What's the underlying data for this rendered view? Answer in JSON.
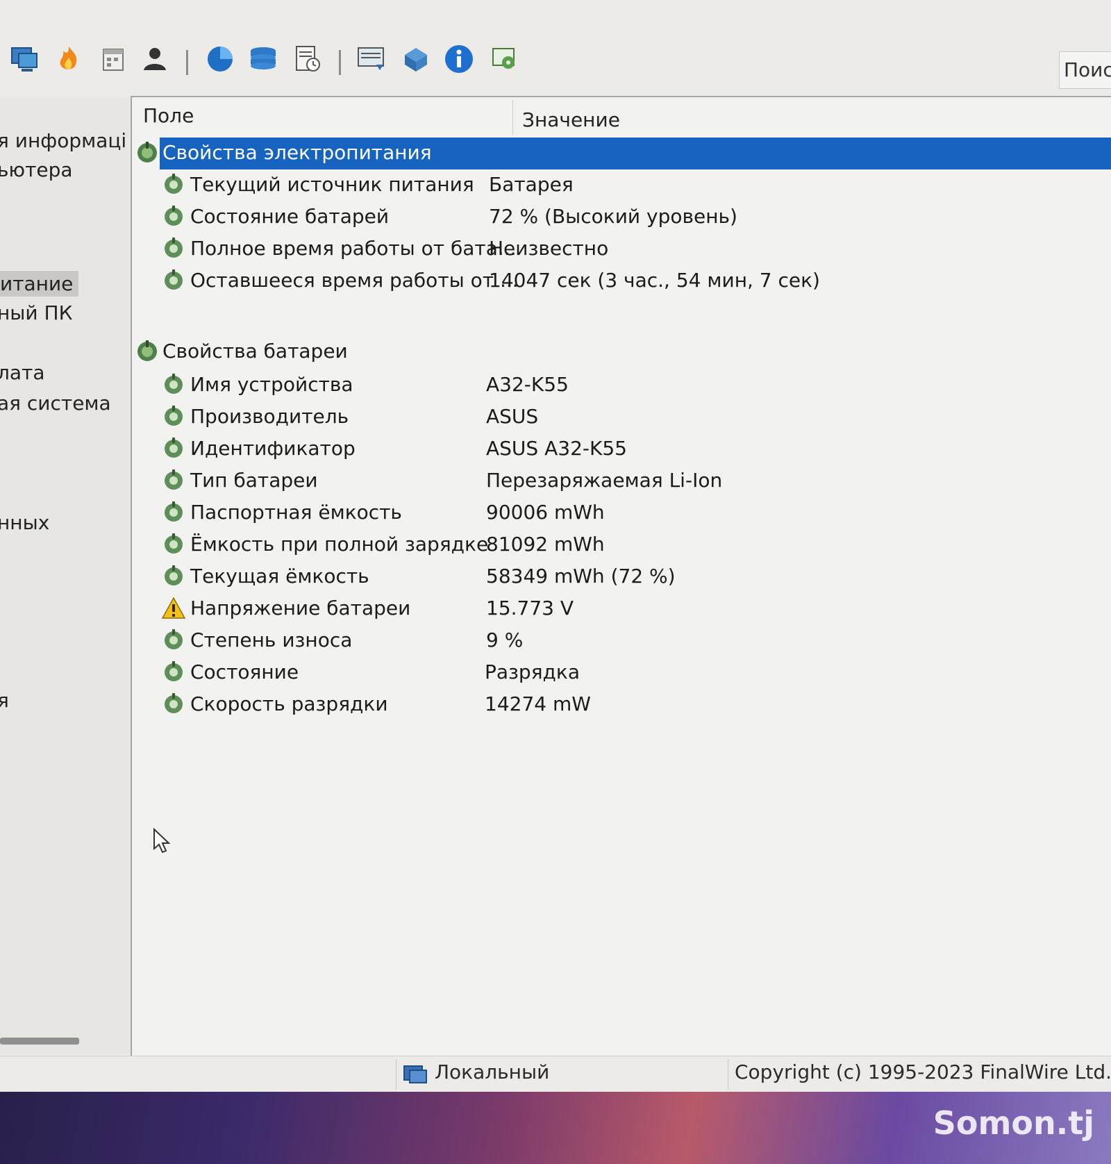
{
  "window": {
    "title_fragment": ""
  },
  "toolbar": {
    "icons": [
      "computer-icon",
      "flame-icon",
      "calendar-icon",
      "user-icon",
      "pie-chart-icon",
      "database-icon",
      "report-icon",
      "monitor-icon",
      "network-icon",
      "info-icon",
      "tools-icon"
    ],
    "search_label": "Поис"
  },
  "left_panel": {
    "items": [
      "я информаці",
      "ьютера",
      "итание",
      "ный ПК",
      "лата",
      "ая система",
      "нных",
      "я"
    ]
  },
  "grid": {
    "columns": [
      "Поле",
      "Значение"
    ],
    "groups": [
      {
        "title": "Свойства электропитания",
        "rows": [
          {
            "field": "Текущий источник питания",
            "value": "Батарея"
          },
          {
            "field": "Состояние батарей",
            "value": "72 % (Высокий уровень)"
          },
          {
            "field": "Полное время работы от бата...",
            "value": "Неизвестно"
          },
          {
            "field": "Оставшееся время работы от ...",
            "value": "14047 сек (3 час., 54 мин, 7 сек)"
          }
        ]
      },
      {
        "title": "Свойства батареи",
        "rows": [
          {
            "field": "Имя устройства",
            "value": "A32-K55"
          },
          {
            "field": "Производитель",
            "value": "ASUS"
          },
          {
            "field": "Идентификатор",
            "value": "ASUS A32-K55"
          },
          {
            "field": "Тип батареи",
            "value": "Перезаряжаемая Li-Ion"
          },
          {
            "field": "Паспортная ёмкость",
            "value": "90006 mWh"
          },
          {
            "field": "Ёмкость при полной зарядке",
            "value": "81092 mWh"
          },
          {
            "field": "Текущая ёмкость",
            "value": "58349 mWh  (72 %)"
          },
          {
            "field": "Напряжение батареи",
            "value": "15.773 V"
          },
          {
            "field": "Степень износа",
            "value": "9 %"
          },
          {
            "field": "Состояние",
            "value": "Разрядка"
          },
          {
            "field": "Скорость разрядки",
            "value": "14274 mW"
          }
        ]
      }
    ]
  },
  "statusbar": {
    "mode": "Локальный",
    "copyright": "Copyright (c) 1995-2023 FinalWire Ltd."
  },
  "watermark": "Somon.tj",
  "colors": {
    "selection": "#1764c0",
    "background": "#f2f2f0"
  }
}
